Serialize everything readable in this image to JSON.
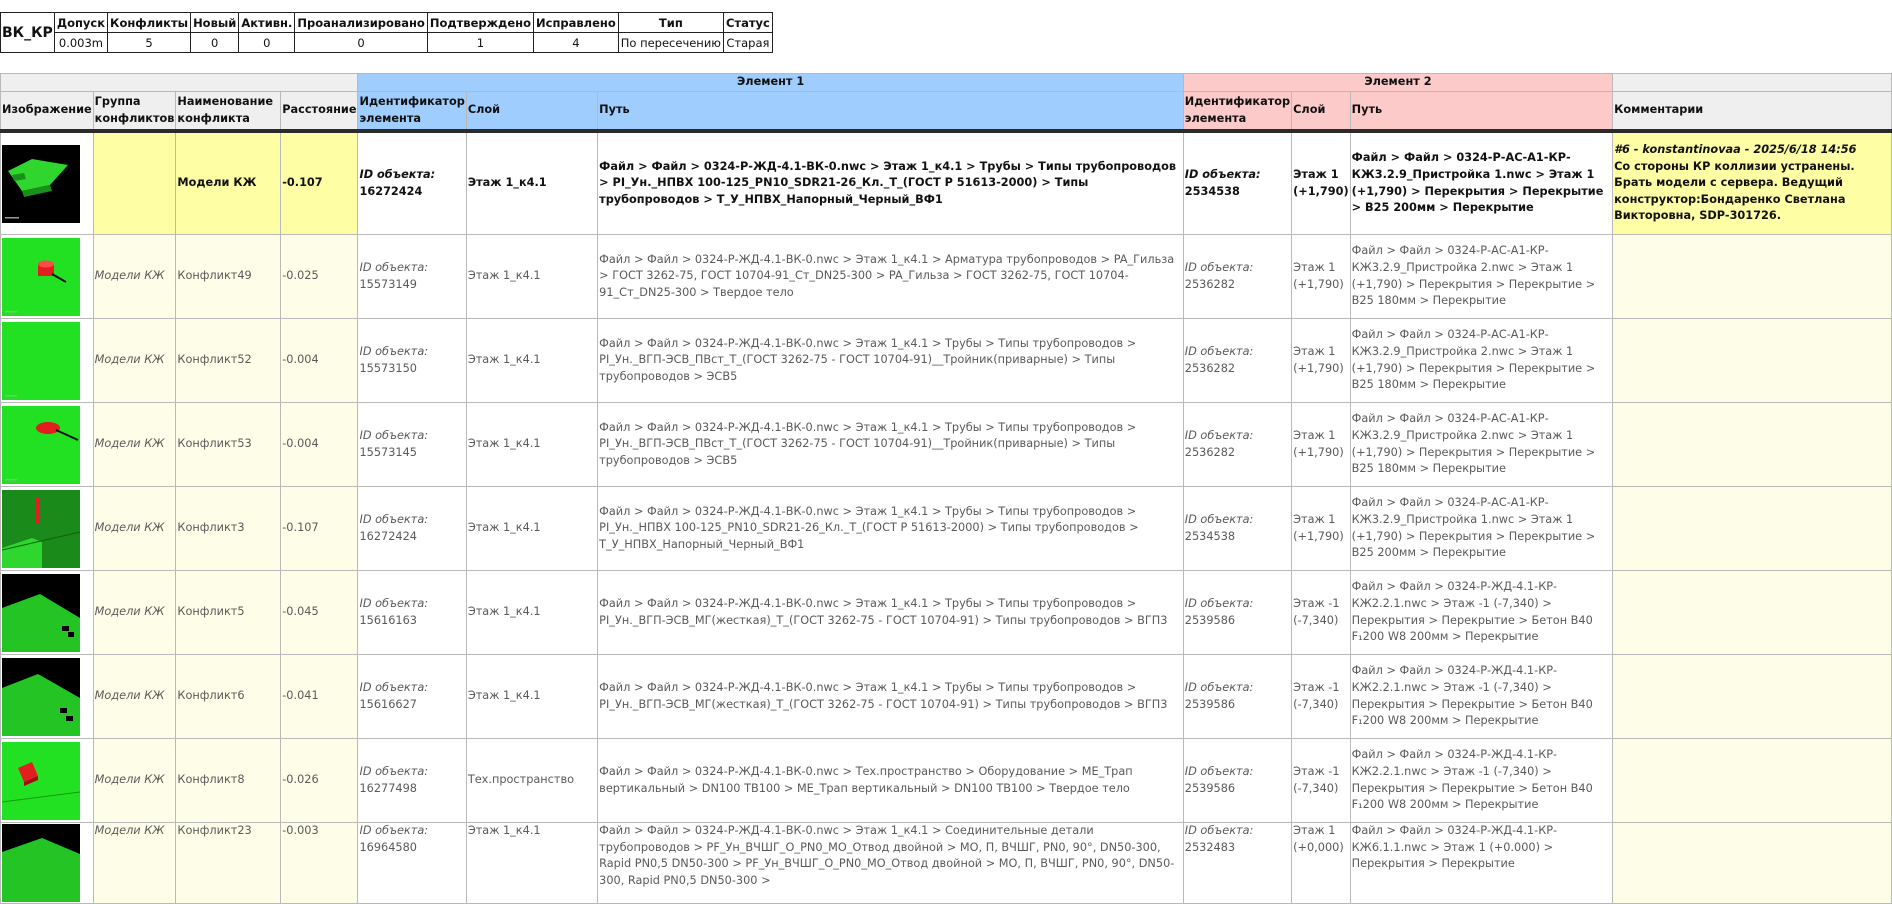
{
  "summary": {
    "test_name": "ВК_КР",
    "headers": [
      "Допуск",
      "Конфликты",
      "Новый",
      "Активн.",
      "Проанализировано",
      "Подтверждено",
      "Исправлено",
      "Тип",
      "Статус"
    ],
    "values": [
      "0.003m",
      "5",
      "0",
      "0",
      "0",
      "1",
      "4",
      "По пересечению",
      "Старая"
    ]
  },
  "table": {
    "group_element1": "Элемент 1",
    "group_element2": "Элемент 2",
    "columns": {
      "image": "Изображение",
      "group": "Группа конфликтов",
      "name": "Наименование конфликта",
      "distance": "Расстояние",
      "id1": "Идентификатор элемента",
      "layer1": "Слой",
      "path1": "Путь",
      "id2": "Идентификатор элемента",
      "layer2": "Слой",
      "path2": "Путь",
      "comments": "Комментарии"
    },
    "id_label": "ID объекта:",
    "rows": [
      {
        "thumb": "thumb-slab-green-dark",
        "group": "",
        "name": "Модели КЖ",
        "distance": "-0.107",
        "id1": "16272424",
        "layer1": "Этаж 1_к4.1",
        "path1": "Файл > Файл > 0324-Р-ЖД-4.1-ВК-0.nwc > Этаж 1_к4.1 > Трубы > Типы трубопроводов > PI_Ун._НПВХ 100-125_PN10_SDR21-26_Кл._Т_(ГОСТ Р 51613-2000) > Типы трубопроводов > Т_У_НПВХ_Напорный_Черный_ВФ1",
        "id2": "2534538",
        "layer2": "Этаж 1 (+1,790)",
        "path2": "Файл > Файл > 0324-Р-АС-А1-КР-КЖ3.2.9_Пристройка 1.nwc > Этаж 1 (+1,790) > Перекрытия > Перекрытие > B25 200мм > Перекрытие",
        "comment_head": "#6 - konstantinovaa - 2025/6/18  14:56",
        "comment_body": "Со стороны КР коллизии устранены. Брать модели с сервера. Ведущий конструктор:Бондаренко Светлана Викторовна, SDP-301726."
      },
      {
        "thumb": "thumb-red-cylinder",
        "group": "Модели КЖ",
        "name": "Конфликт49",
        "distance": "-0.025",
        "id1": "15573149",
        "layer1": "Этаж 1_к4.1",
        "path1": "Файл > Файл > 0324-Р-ЖД-4.1-ВК-0.nwc > Этаж 1_к4.1 > Арматура трубопроводов > PA_Гильза > ГОСТ 3262-75, ГОСТ 10704-91_Ст_DN25-300 > PA_Гильза > ГОСТ 3262-75, ГОСТ 10704-91_Ст_DN25-300 > Твердое тело",
        "id2": "2536282",
        "layer2": "Этаж 1 (+1,790)",
        "path2": "Файл > Файл > 0324-Р-АС-А1-КР-КЖ3.2.9_Пристройка 2.nwc > Этаж 1 (+1,790) > Перекрытия > Перекрытие > B25 180мм > Перекрытие"
      },
      {
        "thumb": "thumb-green-plain",
        "group": "Модели КЖ",
        "name": "Конфликт52",
        "distance": "-0.004",
        "id1": "15573150",
        "layer1": "Этаж 1_к4.1",
        "path1": "Файл > Файл > 0324-Р-ЖД-4.1-ВК-0.nwc > Этаж 1_к4.1 > Трубы > Типы трубопроводов > PI_Ун._ВГП-ЭСВ_ПВст_Т_(ГОСТ 3262-75 - ГОСТ 10704-91)__Тройник(приварные) > Типы трубопроводов > ЭСВ5",
        "id2": "2536282",
        "layer2": "Этаж 1 (+1,790)",
        "path2": "Файл > Файл > 0324-Р-АС-А1-КР-КЖ3.2.9_Пристройка 2.nwc > Этаж 1 (+1,790) > Перекрытия > Перекрытие > B25 180мм > Перекрытие"
      },
      {
        "thumb": "thumb-red-disc",
        "group": "Модели КЖ",
        "name": "Конфликт53",
        "distance": "-0.004",
        "id1": "15573145",
        "layer1": "Этаж 1_к4.1",
        "path1": "Файл > Файл > 0324-Р-ЖД-4.1-ВК-0.nwc > Этаж 1_к4.1 > Трубы > Типы трубопроводов > PI_Ун._ВГП-ЭСВ_ПВст_Т_(ГОСТ 3262-75 - ГОСТ 10704-91)__Тройник(приварные) > Типы трубопроводов > ЭСВ5",
        "id2": "2536282",
        "layer2": "Этаж 1 (+1,790)",
        "path2": "Файл > Файл > 0324-Р-АС-А1-КР-КЖ3.2.9_Пристройка 2.nwc > Этаж 1 (+1,790) > Перекрытия > Перекрытие > B25 180мм > Перекрытие"
      },
      {
        "thumb": "thumb-red-pipe",
        "group": "Модели КЖ",
        "name": "Конфликт3",
        "distance": "-0.107",
        "id1": "16272424",
        "layer1": "Этаж 1_к4.1",
        "path1": "Файл > Файл > 0324-Р-ЖД-4.1-ВК-0.nwc > Этаж 1_к4.1 > Трубы > Типы трубопроводов > PI_Ун._НПВХ 100-125_PN10_SDR21-26_Кл._Т_(ГОСТ Р 51613-2000) > Типы трубопроводов > Т_У_НПВХ_Напорный_Черный_ВФ1",
        "id2": "2534538",
        "layer2": "Этаж 1 (+1,790)",
        "path2": "Файл > Файл > 0324-Р-АС-А1-КР-КЖ3.2.9_Пристройка 1.nwc > Этаж 1 (+1,790) > Перекрытия > Перекрытие > B25 200мм > Перекрытие"
      },
      {
        "thumb": "thumb-slab-black",
        "group": "Модели КЖ",
        "name": "Конфликт5",
        "distance": "-0.045",
        "id1": "15616163",
        "layer1": "Этаж 1_к4.1",
        "path1": "Файл > Файл > 0324-Р-ЖД-4.1-ВК-0.nwc > Этаж 1_к4.1 > Трубы > Типы трубопроводов > PI_Ун._ВГП-ЭСВ_МГ(жесткая)_Т_(ГОСТ 3262-75 - ГОСТ 10704-91) > Типы трубопроводов > ВГП3",
        "id2": "2539586",
        "layer2": "Этаж -1 (-7,340)",
        "path2": "Файл > Файл > 0324-Р-ЖД-4.1-КР-КЖ2.2.1.nwc > Этаж -1 (-7,340) > Перекрытия > Перекрытие > Бетон B40 F₁200 W8 200мм > Перекрытие"
      },
      {
        "thumb": "thumb-slab-black",
        "group": "Модели КЖ",
        "name": "Конфликт6",
        "distance": "-0.041",
        "id1": "15616627",
        "layer1": "Этаж 1_к4.1",
        "path1": "Файл > Файл > 0324-Р-ЖД-4.1-ВК-0.nwc > Этаж 1_к4.1 > Трубы > Типы трубопроводов > PI_Ун._ВГП-ЭСВ_МГ(жесткая)_Т_(ГОСТ 3262-75 - ГОСТ 10704-91) > Типы трубопроводов > ВГП3",
        "id2": "2539586",
        "layer2": "Этаж -1 (-7,340)",
        "path2": "Файл > Файл > 0324-Р-ЖД-4.1-КР-КЖ2.2.1.nwc > Этаж -1 (-7,340) > Перекрытия > Перекрытие > Бетон B40 F₁200 W8 200мм > Перекрытие"
      },
      {
        "thumb": "thumb-red-block",
        "group": "Модели КЖ",
        "name": "Конфликт8",
        "distance": "-0.026",
        "id1": "16277498",
        "layer1": "Тех.пространство",
        "path1": "Файл > Файл > 0324-Р-ЖД-4.1-ВК-0.nwc > Тех.пространство > Оборудование > МЕ_Трап вертикальный > DN100 TB100 > МЕ_Трап вертикальный > DN100 TB100 > Твердое тело",
        "id2": "2539586",
        "layer2": "Этаж -1 (-7,340)",
        "path2": "Файл > Файл > 0324-Р-ЖД-4.1-КР-КЖ2.2.1.nwc > Этаж -1 (-7,340) > Перекрытия > Перекрытие > Бетон B40 F₁200 W8 200мм > Перекрытие"
      },
      {
        "thumb": "thumb-slab-green-dark",
        "group": "Модели КЖ",
        "name": "Конфликт23",
        "distance": "-0.003",
        "id1": "16964580",
        "layer1": "Этаж 1_к4.1",
        "path1": "Файл > Файл > 0324-Р-ЖД-4.1-ВК-0.nwc > Этаж 1_к4.1 > Соединительные детали трубопроводов > PF_Ун_ВЧШГ_О_PN0_МО_Отвод двойной > МО, П, ВЧШГ, PN0, 90°, DN50-300, Rapid PN0,5 DN50-300 > PF_Ун_ВЧШГ_О_PN0_МО_Отвод двойной > МО, П, ВЧШГ, PN0, 90°, DN50-300, Rapid PN0,5 DN50-300 >",
        "id2": "2532483",
        "layer2": "Этаж 1 (+0,000)",
        "path2": "Файл > Файл > 0324-Р-ЖД-4.1-КР-КЖ6.1.1.nwc > Этаж 1 (+0.000) > Перекрытия > Перекрытие"
      }
    ]
  }
}
